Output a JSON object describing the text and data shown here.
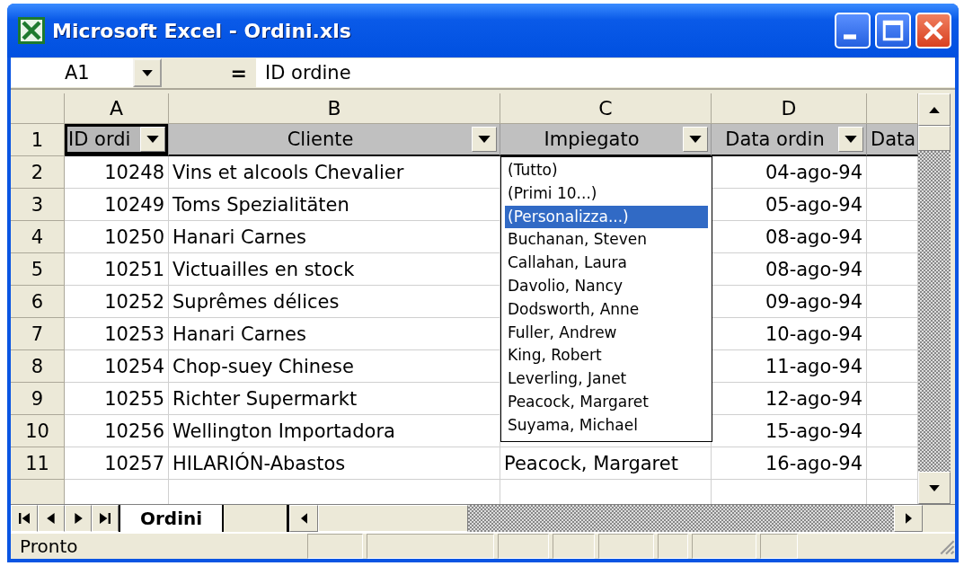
{
  "window": {
    "title": "Microsoft Excel - Ordini.xls"
  },
  "formula_bar": {
    "name_box": "A1",
    "equals": "=",
    "content": "ID ordine"
  },
  "columns": [
    "A",
    "B",
    "C",
    "D"
  ],
  "header_row": {
    "number": "1",
    "cells": [
      {
        "text": "ID ordi",
        "selected": true
      },
      {
        "text": "Cliente",
        "selected": false
      },
      {
        "text": "Impiegato",
        "selected": false
      },
      {
        "text": "Data ordin",
        "selected": false
      },
      {
        "text": "Data",
        "selected": false
      }
    ]
  },
  "rows": [
    {
      "number": "2",
      "id": "10248",
      "cliente": "Vins et alcools Chevalier",
      "data": "04-ago-94"
    },
    {
      "number": "3",
      "id": "10249",
      "cliente": "Toms Spezialitäten",
      "data": "05-ago-94"
    },
    {
      "number": "4",
      "id": "10250",
      "cliente": "Hanari Carnes",
      "data": "08-ago-94"
    },
    {
      "number": "5",
      "id": "10251",
      "cliente": "Victuailles en stock",
      "data": "08-ago-94"
    },
    {
      "number": "6",
      "id": "10252",
      "cliente": "Suprêmes délices",
      "data": "09-ago-94"
    },
    {
      "number": "7",
      "id": "10253",
      "cliente": "Hanari Carnes",
      "data": "10-ago-94"
    },
    {
      "number": "8",
      "id": "10254",
      "cliente": "Chop-suey Chinese",
      "data": "11-ago-94"
    },
    {
      "number": "9",
      "id": "10255",
      "cliente": "Richter Supermarkt",
      "data": "12-ago-94"
    },
    {
      "number": "10",
      "id": "10256",
      "cliente": "Wellington Importadora",
      "data": "15-ago-94"
    },
    {
      "number": "11",
      "id": "10257",
      "cliente": "HILARIÓN-Abastos",
      "impiegato": "Peacock, Margaret",
      "data": "16-ago-94"
    }
  ],
  "filter_dropdown": {
    "items": [
      {
        "label": "(Tutto)",
        "selected": false
      },
      {
        "label": "(Primi 10...)",
        "selected": false
      },
      {
        "label": "(Personalizza...)",
        "selected": true
      },
      {
        "label": "Buchanan, Steven",
        "selected": false
      },
      {
        "label": "Callahan, Laura",
        "selected": false
      },
      {
        "label": "Davolio, Nancy",
        "selected": false
      },
      {
        "label": "Dodsworth, Anne",
        "selected": false
      },
      {
        "label": "Fuller, Andrew",
        "selected": false
      },
      {
        "label": "King, Robert",
        "selected": false
      },
      {
        "label": "Leverling, Janet",
        "selected": false
      },
      {
        "label": "Peacock, Margaret",
        "selected": false
      },
      {
        "label": "Suyama, Michael",
        "selected": false
      }
    ]
  },
  "sheet_tabs": [
    {
      "label": "Ordini",
      "selected": true
    }
  ],
  "status_bar": {
    "text": "Pronto"
  }
}
